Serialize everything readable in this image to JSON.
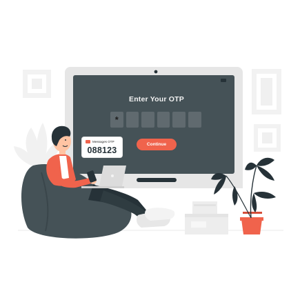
{
  "screen": {
    "title": "Enter Your OTP",
    "otp_boxes": [
      "*",
      "",
      "",
      "",
      "",
      ""
    ],
    "continue_label": "Continue"
  },
  "message": {
    "label": "Messages OTP",
    "code": "088123"
  },
  "colors": {
    "accent": "#f0634c",
    "monitor_dark": "#455257",
    "ink": "#263238"
  },
  "icons": [
    "message-icon",
    "camera-icon"
  ]
}
